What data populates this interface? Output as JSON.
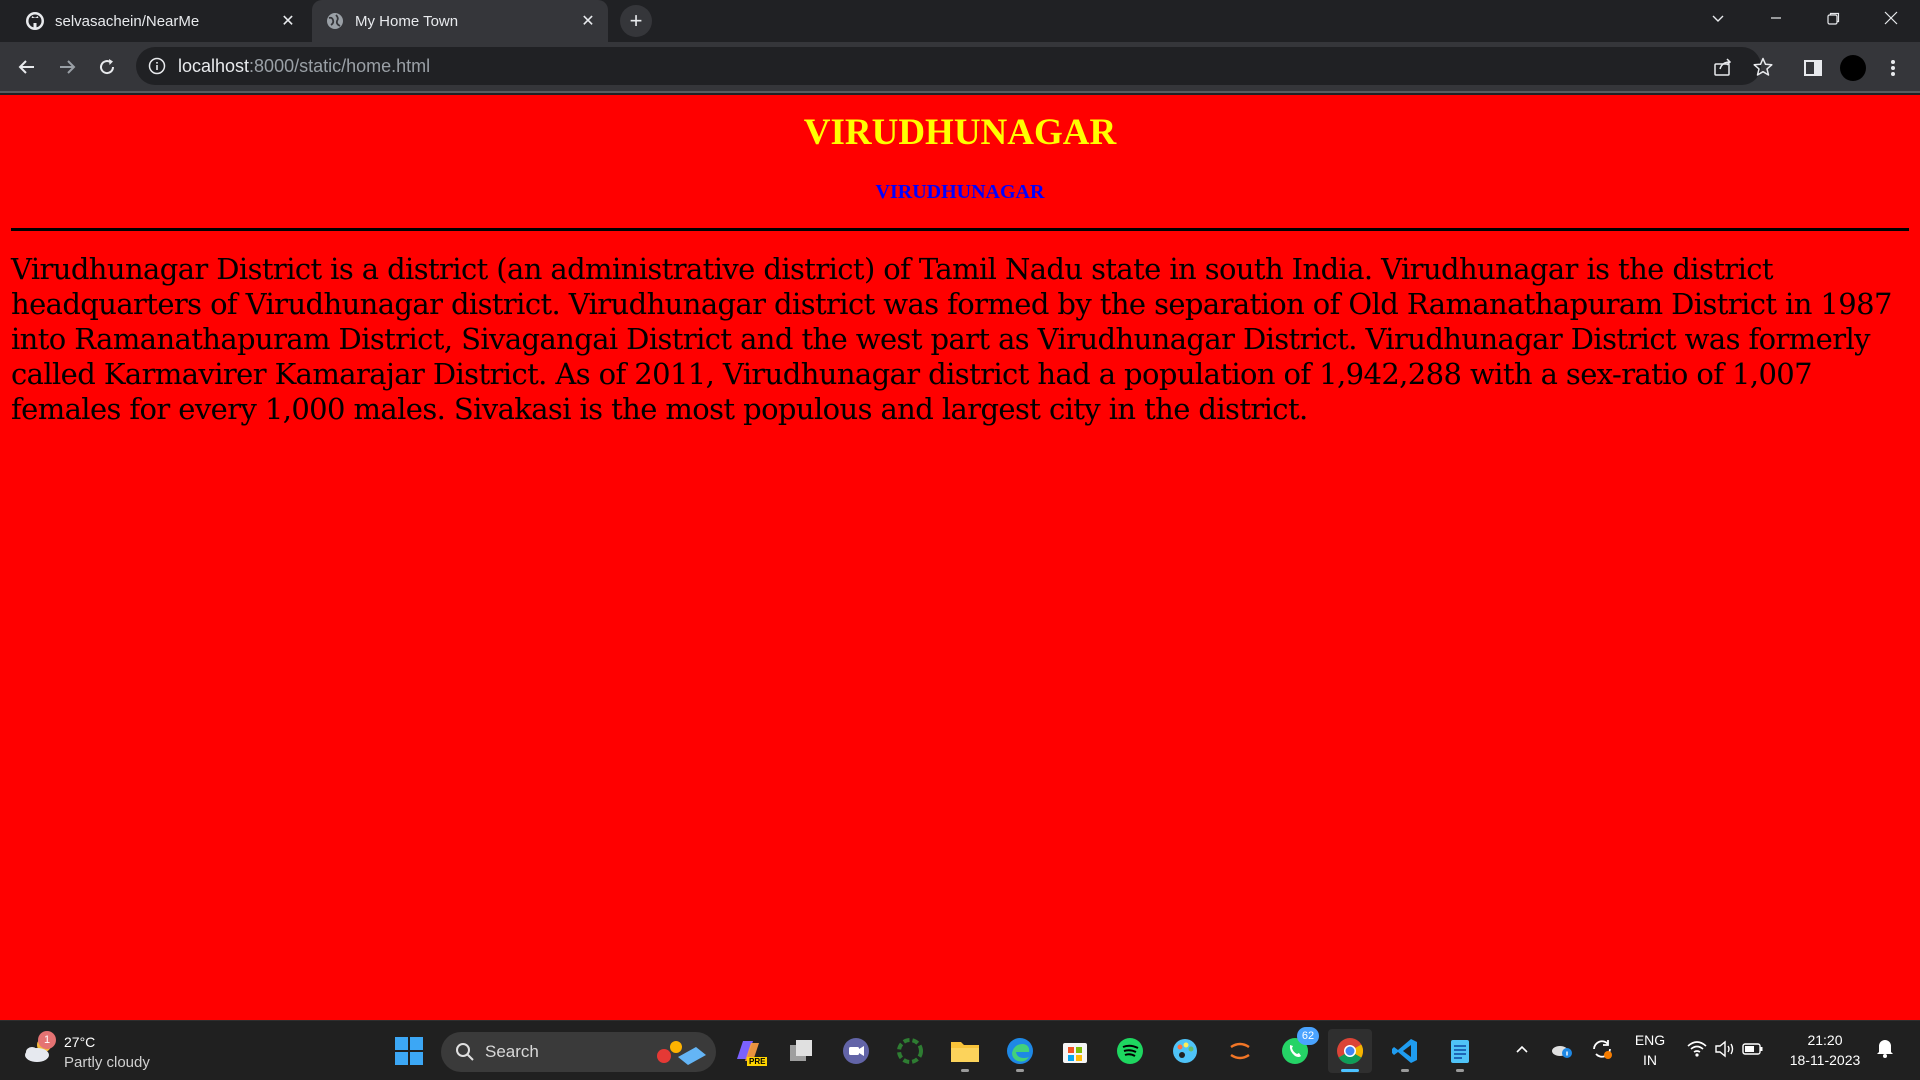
{
  "browser": {
    "tabs": [
      {
        "title": "selvasachein/NearMe",
        "icon": "github-icon"
      },
      {
        "title": "My Home Town",
        "icon": "globe-icon"
      }
    ],
    "url_host": "localhost",
    "url_path": ":8000/static/home.html"
  },
  "page": {
    "heading": "VIRUDHUNAGAR",
    "subheading": "VIRUDHUNAGAR",
    "paragraph": "Virudhunagar District is a district (an administrative district) of Tamil Nadu state in south India. Virudhunagar is the district headquarters of Virudhunagar district. Virudhunagar district was formed by the separation of Old Ramanathapuram District in 1987 into Ramanathapuram District, Sivagangai District and the west part as Virudhunagar District. Virudhunagar District was formerly called Karmavirer Kamarajar District. As of 2011, Virudhunagar district had a population of 1,942,288 with a sex-ratio of 1,007 females for every 1,000 males. Sivakasi is the most populous and largest city in the district.",
    "colors": {
      "background": "#ff0000",
      "heading": "#ffff00",
      "subheading": "#0000ff",
      "text": "#000000"
    }
  },
  "taskbar": {
    "weather_badge": "1",
    "temperature": "27°C",
    "condition": "Partly cloudy",
    "search_label": "Search",
    "whatsapp_badge": "62",
    "language": "ENG",
    "region": "IN",
    "time": "21:20",
    "date": "18-11-2023",
    "copilot_tag": "PRE"
  }
}
